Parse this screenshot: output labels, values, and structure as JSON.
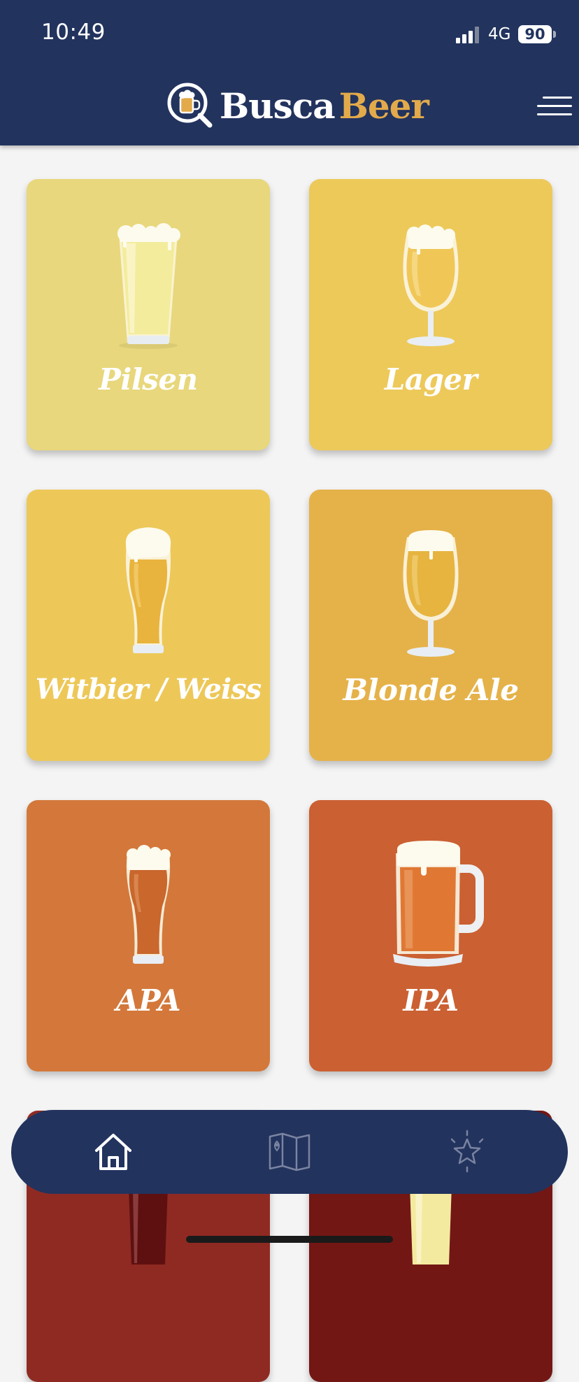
{
  "status_bar": {
    "time": "10:49",
    "network": "4G",
    "battery": "90"
  },
  "header": {
    "logo_part1": "Busca",
    "logo_part2": "Beer",
    "logo_icon": "beer-magnifier-icon",
    "menu_icon": "hamburger-menu-icon"
  },
  "styles": [
    {
      "label": "Pilsen",
      "color": "#e8d77c",
      "icon": "pilsner-glass-icon"
    },
    {
      "label": "Lager",
      "color": "#edc95a",
      "icon": "tulip-glass-icon"
    },
    {
      "label": "Witbier / Weiss",
      "color": "#edc859",
      "icon": "weizen-glass-icon"
    },
    {
      "label": "Blonde Ale",
      "color": "#e5b24a",
      "icon": "tulip-glass-icon"
    },
    {
      "label": "APA",
      "color": "#d3783a",
      "icon": "pint-glass-icon"
    },
    {
      "label": "IPA",
      "color": "#cb6032",
      "icon": "mug-icon"
    },
    {
      "label": "",
      "color": "#8f2a23",
      "icon": "dark-beer-glass-icon"
    },
    {
      "label": "",
      "color": "#731714",
      "icon": "light-beer-glass-icon"
    }
  ],
  "bottom_nav": {
    "items": [
      {
        "icon": "home-icon",
        "active": true
      },
      {
        "icon": "map-icon",
        "active": false
      },
      {
        "icon": "star-icon",
        "active": false
      }
    ]
  },
  "colors": {
    "navy": "#22335e",
    "brand_gold": "#e2aa4b",
    "background": "#f4f4f4"
  }
}
